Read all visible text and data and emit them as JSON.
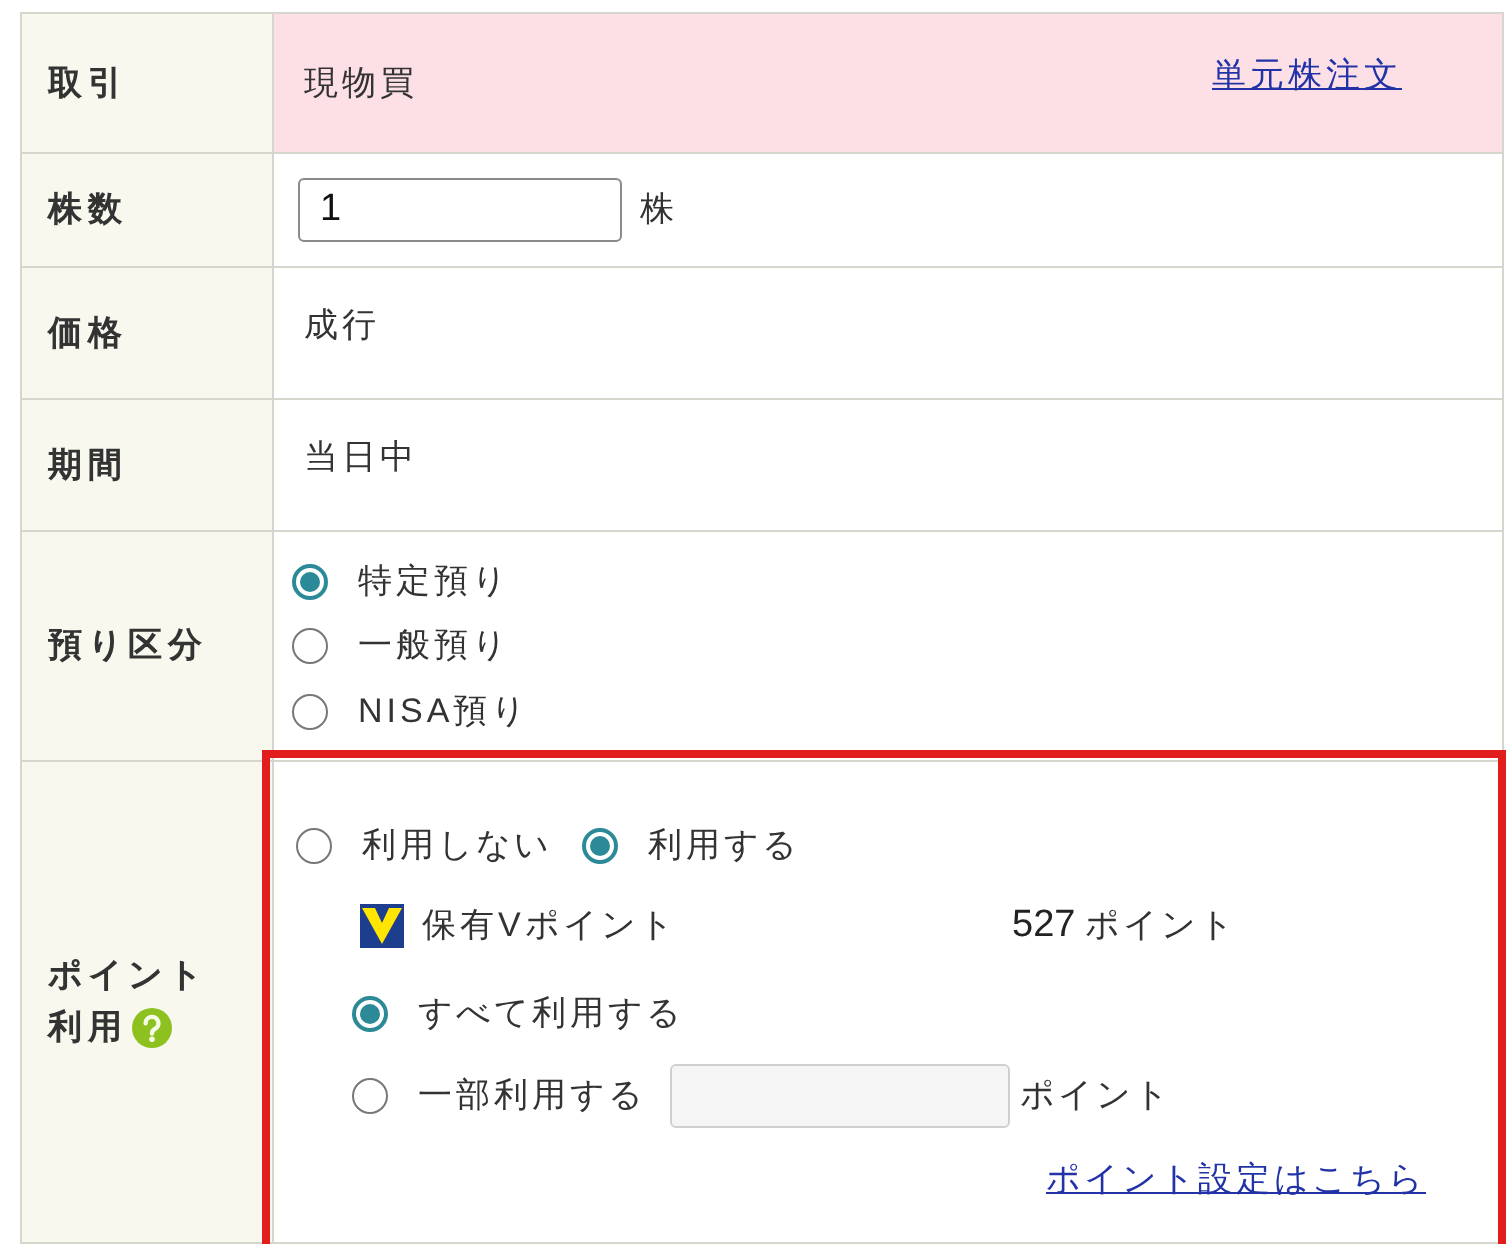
{
  "rows": [
    {
      "kind": "trade",
      "label": "取引",
      "value": "現物買",
      "link": "単元株注文"
    },
    {
      "kind": "quantity",
      "label": "株数",
      "value": "1",
      "unit": "株"
    },
    {
      "kind": "text",
      "label": "価格",
      "value": "成行"
    },
    {
      "kind": "text",
      "label": "期間",
      "value": "当日中"
    },
    {
      "kind": "account",
      "label": "預り区分",
      "options": [
        {
          "label": "特定預り",
          "selected": true
        },
        {
          "label": "一般預り",
          "selected": false
        },
        {
          "label": "NISA預り",
          "selected": false
        }
      ]
    },
    {
      "kind": "points",
      "label_lines": [
        "ポイント",
        "利用"
      ],
      "help": true,
      "highlighted": true,
      "use_options": [
        {
          "label": "利用しない",
          "selected": false
        },
        {
          "label": "利用する",
          "selected": true
        }
      ],
      "balance_label": "保有Vポイント",
      "balance": "527",
      "balance_unit": "ポイント",
      "amount_options": [
        {
          "kind": "all",
          "label": "すべて利用する",
          "selected": true
        },
        {
          "kind": "partial",
          "label": "一部利用する",
          "selected": false,
          "unit": "ポイント"
        }
      ],
      "settings_link": "ポイント設定はこちら"
    }
  ]
}
